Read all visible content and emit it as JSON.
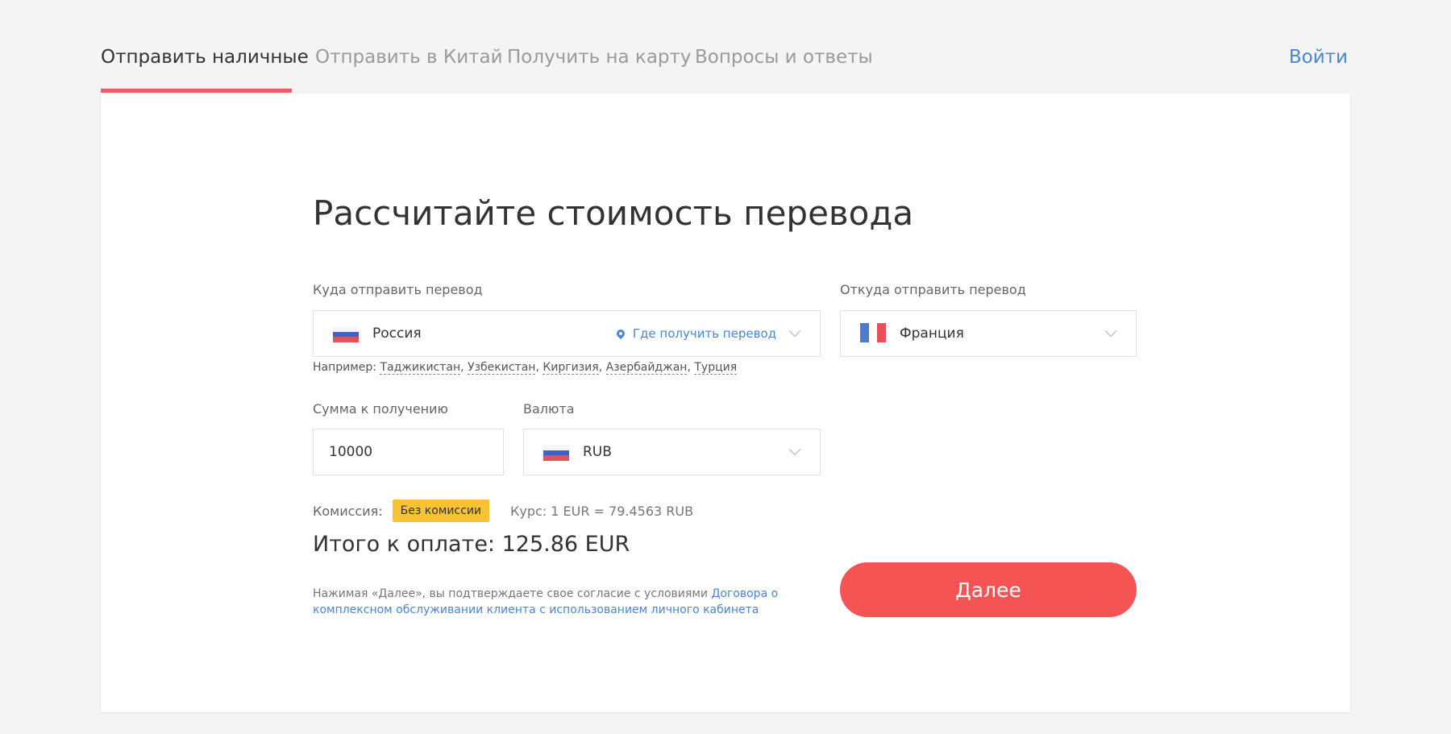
{
  "nav": {
    "tabs": [
      {
        "label": "Отправить наличные"
      },
      {
        "label": "Отправить в Китай"
      },
      {
        "label": "Получить на карту"
      },
      {
        "label": "Вопросы и ответы"
      }
    ],
    "login": "Войти"
  },
  "form": {
    "title": "Рассчитайте стоимость перевода",
    "to_label": "Куда отправить перевод",
    "to_value": "Россия",
    "where_link": "Где получить перевод",
    "from_label": "Откуда отправить перевод",
    "from_value": "Франция",
    "examples_prefix": "Например:",
    "examples": [
      "Таджикистан",
      "Узбекистан",
      "Киргизия",
      "Азербайджан",
      "Турция"
    ],
    "amount_label": "Сумма к получению",
    "amount_value": "10000",
    "currency_label": "Валюта",
    "currency_value": "RUB",
    "commission_label": "Комиссия:",
    "commission_badge": "Без комиссии",
    "rate": "Курс: 1 EUR = 79.4563 RUB",
    "total": "Итого к оплате: 125.86 EUR",
    "agreement_text": "Нажимая «Далее», вы подтверждаете свое согласие с условиями ",
    "agreement_link": "Договора о комплексном обслуживании клиента с использованием личного кабинета",
    "next_button": "Далее"
  },
  "colors": {
    "accent_red": "#f65454",
    "link_blue": "#4a86d6",
    "badge_yellow": "#f7c334"
  }
}
